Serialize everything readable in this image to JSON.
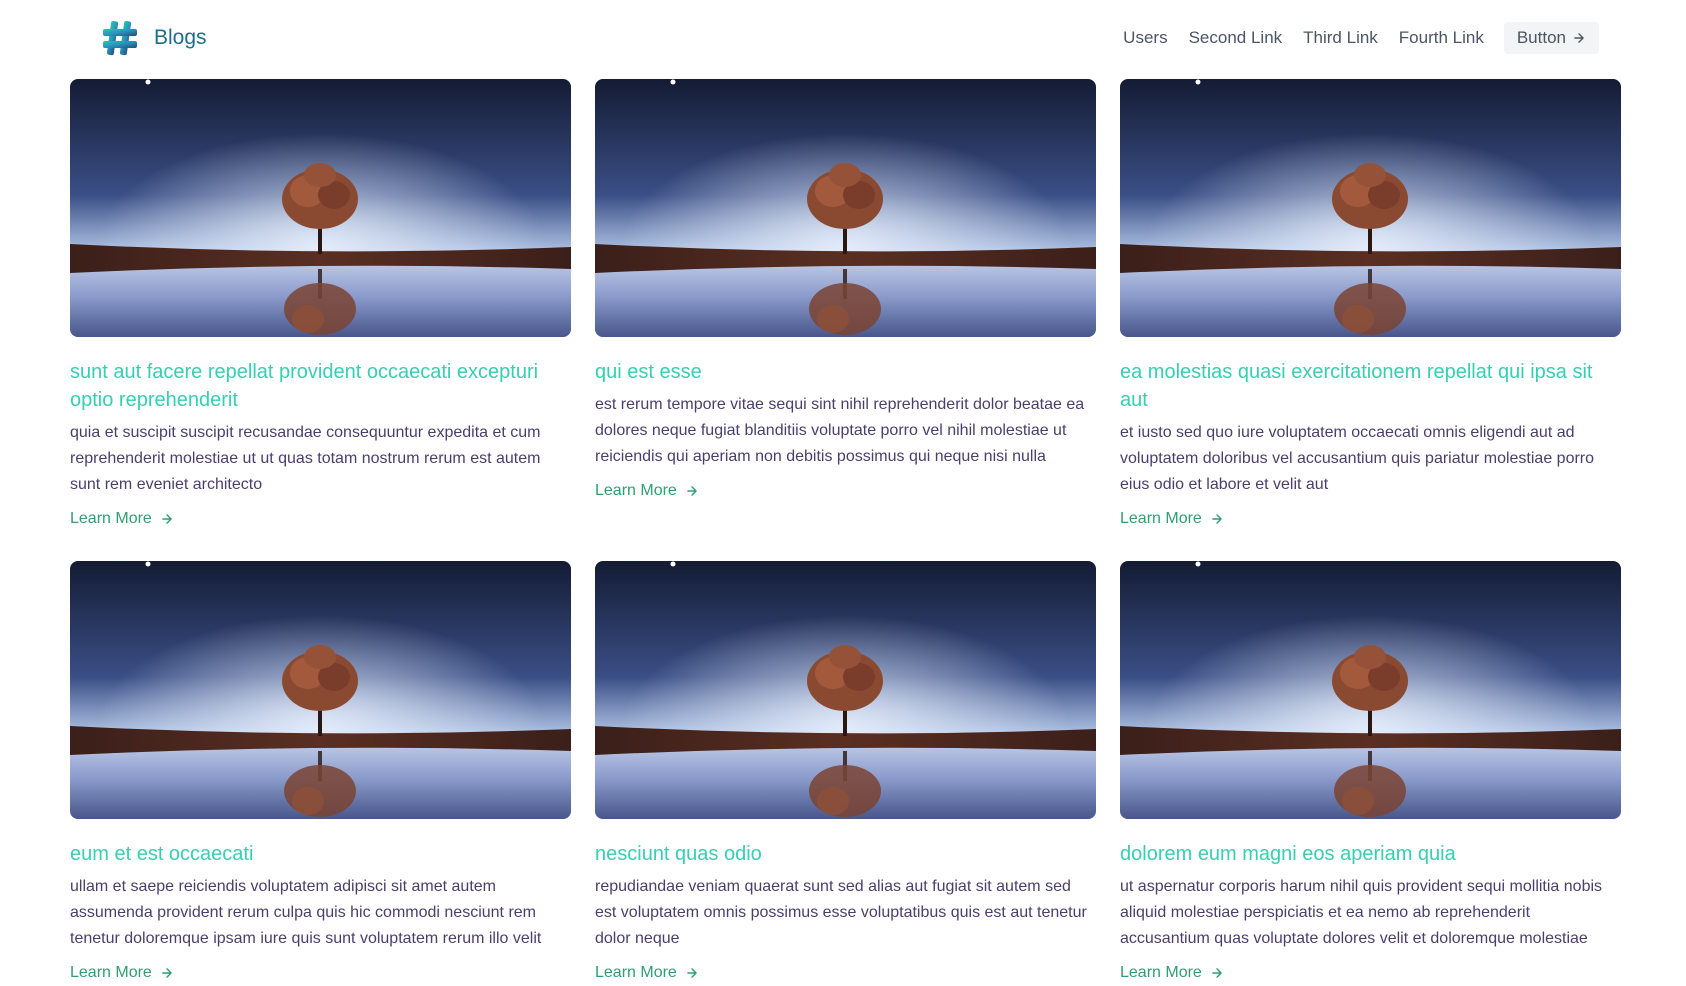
{
  "header": {
    "brand": "Blogs",
    "nav": [
      "Users",
      "Second Link",
      "Third Link",
      "Fourth Link"
    ],
    "button_label": "Button",
    "button_icon": "arrow-right-icon"
  },
  "colors": {
    "brand": "#1c6e8c",
    "title": "#36cfb2",
    "body": "#4a3f6b",
    "link": "#2f9e73"
  },
  "cards": [
    {
      "title": "sunt aut facere repellat provident occaecati excepturi optio reprehenderit",
      "body": "quia et suscipit suscipit recusandae consequuntur expedita et cum reprehenderit molestiae ut ut quas totam nostrum rerum est autem sunt rem eveniet architecto",
      "link": "Learn More"
    },
    {
      "title": "qui est esse",
      "body": "est rerum tempore vitae sequi sint nihil reprehenderit dolor beatae ea dolores neque fugiat blanditiis voluptate porro vel nihil molestiae ut reiciendis qui aperiam non debitis possimus qui neque nisi nulla",
      "link": "Learn More"
    },
    {
      "title": "ea molestias quasi exercitationem repellat qui ipsa sit aut",
      "body": "et iusto sed quo iure voluptatem occaecati omnis eligendi aut ad voluptatem doloribus vel accusantium quis pariatur molestiae porro eius odio et labore et velit aut",
      "link": "Learn More"
    },
    {
      "title": "eum et est occaecati",
      "body": "ullam et saepe reiciendis voluptatem adipisci sit amet autem assumenda provident rerum culpa quis hic commodi nesciunt rem tenetur doloremque ipsam iure quis sunt voluptatem rerum illo velit",
      "link": "Learn More"
    },
    {
      "title": "nesciunt quas odio",
      "body": "repudiandae veniam quaerat sunt sed alias aut fugiat sit autem sed est voluptatem omnis possimus esse voluptatibus quis est aut tenetur dolor neque",
      "link": "Learn More"
    },
    {
      "title": "dolorem eum magni eos aperiam quia",
      "body": "ut aspernatur corporis harum nihil quis provident sequi mollitia nobis aliquid molestiae perspiciatis et ea nemo ab reprehenderit accusantium quas voluptate dolores velit et doloremque molestiae",
      "link": "Learn More"
    }
  ]
}
